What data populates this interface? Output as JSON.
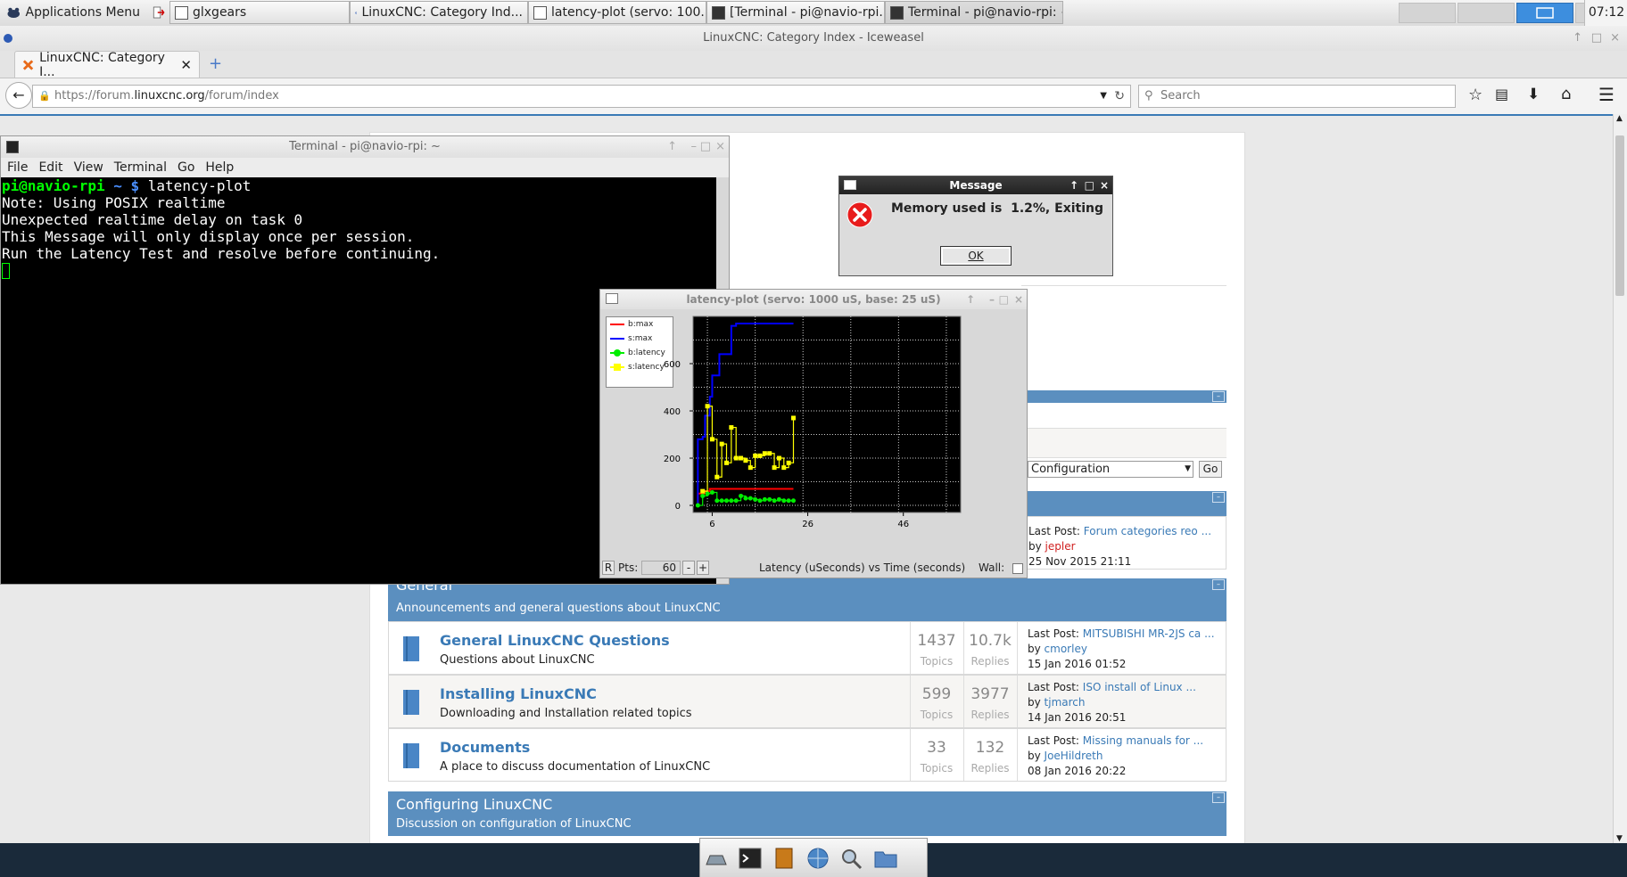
{
  "panel": {
    "apps_menu": "Applications Menu",
    "tasks": [
      {
        "label": "glxgears"
      },
      {
        "label": "LinuxCNC: Category Ind..."
      },
      {
        "label": "latency-plot (servo: 100..."
      },
      {
        "label": "[Terminal - pi@navio-rpi..."
      },
      {
        "label": "Terminal - pi@navio-rpi: ~"
      }
    ],
    "clock": "07:12"
  },
  "browser": {
    "window_title": "LinuxCNC: Category Index - Iceweasel",
    "tab_label": "LinuxCNC: Category I...",
    "url_prefix": "https://forum.",
    "url_domain": "linuxcnc.org",
    "url_path": "/forum/index",
    "search_placeholder": "Search"
  },
  "forum": {
    "select_value": "Configuration",
    "go_label": "Go",
    "top_last_post": {
      "prefix": "Last Post:",
      "title": "Forum categories reo ...",
      "by": "by",
      "user": "jepler",
      "date": "25 Nov 2015 21:11"
    },
    "general": {
      "title": "General",
      "desc": "Announcements and general questions about LinuxCNC",
      "rows": [
        {
          "title": "General LinuxCNC Questions",
          "desc": "Questions about LinuxCNC",
          "topics": "1437",
          "replies": "10.7k",
          "topics_lbl": "Topics",
          "replies_lbl": "Replies",
          "lp_prefix": "Last Post:",
          "lp_title": "MITSUBISHI MR-2JS ca ...",
          "by": "by",
          "user": "cmorley",
          "date": "15 Jan 2016 01:52"
        },
        {
          "title": "Installing LinuxCNC",
          "desc": "Downloading and Installation related topics",
          "topics": "599",
          "replies": "3977",
          "topics_lbl": "Topics",
          "replies_lbl": "Replies",
          "lp_prefix": "Last Post:",
          "lp_title": "ISO install of Linux ...",
          "by": "by",
          "user": "tjmarch",
          "date": "14 Jan 2016 20:51"
        },
        {
          "title": "Documents",
          "desc": "A place to discuss documentation of LinuxCNC",
          "topics": "33",
          "replies": "132",
          "topics_lbl": "Topics",
          "replies_lbl": "Replies",
          "lp_prefix": "Last Post:",
          "lp_title": "Missing manuals for ...",
          "by": "by",
          "user": "JoeHildreth",
          "date": "08 Jan 2016 20:22"
        }
      ]
    },
    "configuring": {
      "title": "Configuring LinuxCNC",
      "desc": "Discussion on configuration of LinuxCNC"
    }
  },
  "terminal": {
    "title": "Terminal - pi@navio-rpi: ~",
    "menu": [
      "File",
      "Edit",
      "View",
      "Terminal",
      "Go",
      "Help"
    ],
    "prompt_user": "pi@navio-rpi",
    "prompt_path": "~ $",
    "command": "latency-plot",
    "lines": [
      "Note: Using POSIX realtime",
      "Unexpected realtime delay on task 0",
      "This Message will only display once per session.",
      "Run the Latency Test and resolve before continuing."
    ]
  },
  "latency_plot": {
    "title": "latency-plot (servo: 1000 uS, base: 25 uS)",
    "r_label": "R",
    "pts_label": "Pts:",
    "pts_value": "60",
    "minus": "-",
    "plus": "+",
    "footer": "Latency (uSeconds) vs Time (seconds)",
    "wall_label": "Wall:"
  },
  "message": {
    "title": "Message",
    "text": "Memory used is  1.2%, Exiting",
    "ok": "OK"
  },
  "chart_data": {
    "type": "line",
    "title": "",
    "xlabel": "",
    "ylabel": "",
    "xlim": [
      2,
      58
    ],
    "ylim": [
      -30,
      800
    ],
    "xticks": [
      "6",
      "26",
      "46"
    ],
    "yticks": [
      "0",
      "200",
      "400",
      "600"
    ],
    "grid": true,
    "legend_position": "left",
    "series": [
      {
        "name": "b:max",
        "color": "#ff0000",
        "x": [
          3.0,
          4.5,
          5.5,
          7,
          9,
          12,
          15,
          18,
          23
        ],
        "y": [
          0,
          50,
          60,
          70,
          70,
          70,
          70,
          70,
          70
        ]
      },
      {
        "name": "s:max",
        "color": "#0000ff",
        "x": [
          3.0,
          4.0,
          4.5,
          5.5,
          6.0,
          7.5,
          8.5,
          10.0,
          11.0,
          13.5,
          23.0
        ],
        "y": [
          0,
          280,
          290,
          380,
          460,
          550,
          640,
          640,
          760,
          770,
          770
        ]
      },
      {
        "name": "b:latency",
        "color": "#00ee00",
        "x": [
          3,
          4,
          5,
          6,
          7,
          8,
          9,
          10,
          11,
          12,
          13,
          14,
          15,
          16,
          17,
          18,
          19,
          20,
          21,
          22,
          23
        ],
        "y": [
          0,
          40,
          50,
          55,
          20,
          20,
          20,
          20,
          20,
          40,
          30,
          30,
          25,
          20,
          25,
          25,
          20,
          25,
          20,
          20,
          20
        ]
      },
      {
        "name": "s:latency",
        "color": "#ffff00",
        "x": [
          4,
          5,
          6,
          7,
          8,
          9,
          10,
          11,
          12,
          13,
          14,
          15,
          16,
          17,
          18,
          19,
          20,
          21,
          22,
          23
        ],
        "y": [
          60,
          420,
          280,
          120,
          260,
          180,
          330,
          200,
          200,
          190,
          160,
          210,
          210,
          220,
          220,
          160,
          200,
          160,
          180,
          370
        ]
      }
    ]
  }
}
